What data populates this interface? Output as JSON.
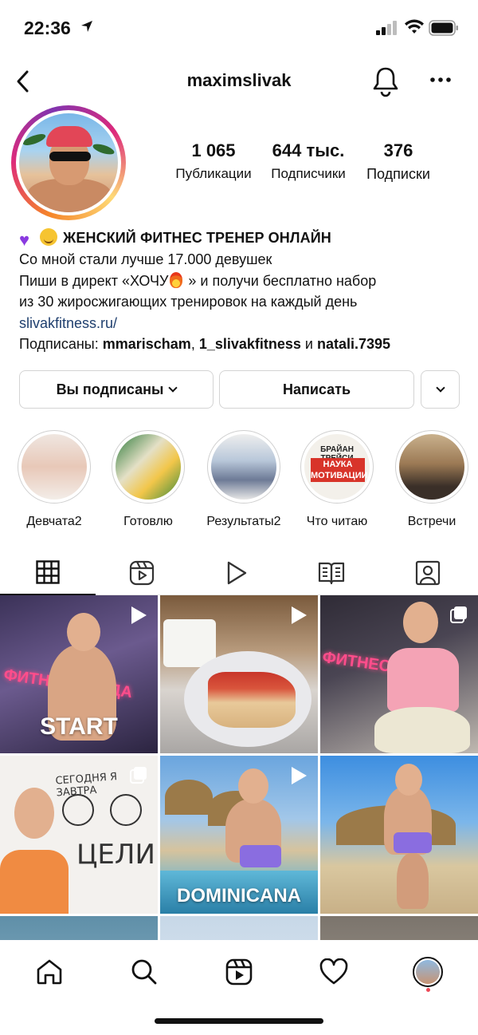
{
  "status_bar": {
    "time": "22:36"
  },
  "header": {
    "username": "maximslivak"
  },
  "profile": {
    "stats": [
      {
        "value": "1 065",
        "label": "Публикации"
      },
      {
        "value": "644 тыс.",
        "label": "Подписчики"
      },
      {
        "value": "376",
        "label": "Подписки"
      }
    ],
    "bio": {
      "name": "ЖЕНСКИЙ ФИТНЕС ТРЕНЕР ОНЛАЙН",
      "line1": "Со мной стали лучше 17.000 девушек",
      "line2_part1": "Пиши в директ «ХОЧУ",
      "line2_part2": " » и получи бесплатно набор",
      "line3": "из 30 жиросжигающих тренировок на каждый день",
      "link": "slivakfitness.ru/",
      "followed_prefix": "Подписаны: ",
      "followed_users": [
        "mmarischam",
        "1_slivakfitness",
        "natali.7395"
      ],
      "followed_sep": ", ",
      "followed_and": " и "
    }
  },
  "actions": {
    "subscribed_label": "Вы подписаны",
    "message_label": "Написать"
  },
  "highlights": [
    {
      "label": "Девчата2"
    },
    {
      "label": "Готовлю"
    },
    {
      "label": "Результаты2"
    },
    {
      "label": "Что читаю",
      "cover_line1": "БРАЙАН ТРЕЙСИ",
      "cover_line2": "НАУКА МОТИВАЦИИ"
    },
    {
      "label": "Встречи"
    }
  ],
  "posts": [
    {
      "overlay": "START",
      "neon": "ФИТНЕС БАНДА",
      "type": "reel"
    },
    {
      "type": "reel"
    },
    {
      "neon": "ФИТНЕС БАНДА",
      "type": "carousel"
    },
    {
      "handwriting_top": "СЕГОДНЯ Я ЗАВТРА",
      "handwriting_bottom": "ЦЕЛИ",
      "type": "carousel"
    },
    {
      "overlay": "DOMINICANA",
      "type": "reel"
    },
    {
      "type": "photo"
    }
  ],
  "icons": {
    "back": "chevron-left-icon",
    "bell": "bell-icon",
    "more": "more-horizontal-icon",
    "tabs": [
      "grid-icon",
      "reels-icon",
      "video-icon",
      "guide-icon",
      "tagged-icon"
    ],
    "nav": [
      "home-icon",
      "search-icon",
      "reels-icon",
      "heart-icon",
      "profile-avatar"
    ]
  },
  "colors": {
    "link": "#1f3f6e",
    "notification_dot": "#ed4956",
    "ring_start": "#f58529",
    "ring_mid": "#dd2a7b"
  }
}
